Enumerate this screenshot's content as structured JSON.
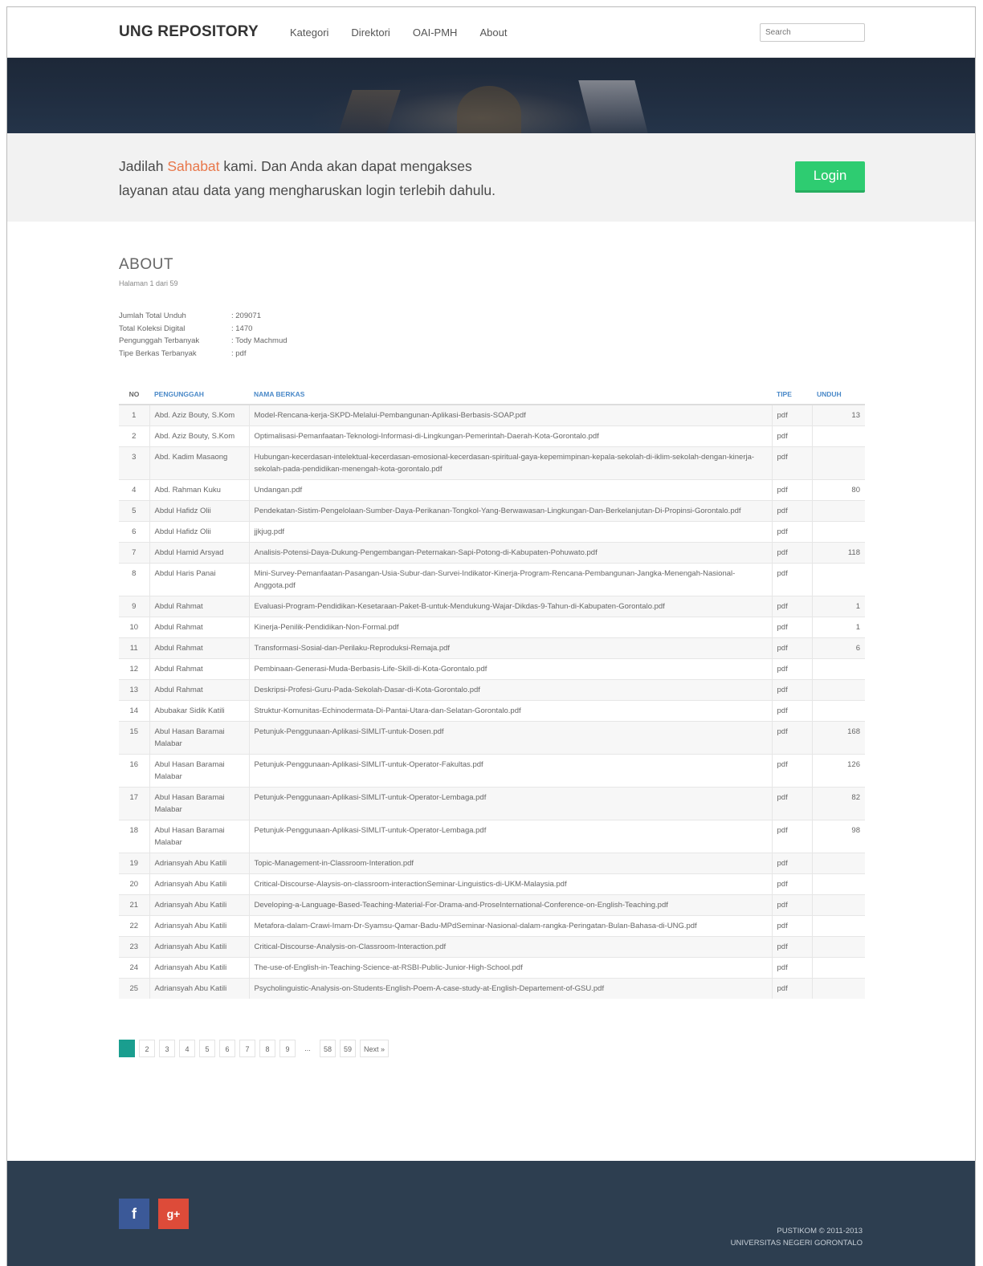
{
  "navbar": {
    "brand": "UNG REPOSITORY",
    "links": [
      "Kategori",
      "Direktori",
      "OAI-PMH",
      "About"
    ],
    "search_placeholder": "Search"
  },
  "callout": {
    "line1_a": "Jadilah ",
    "line1_hl": "Sahabat",
    "line1_b": " kami. Dan Anda akan dapat mengakses",
    "line2": "layanan atau data yang mengharuskan login terlebih dahulu.",
    "login_label": "Login"
  },
  "about": {
    "title": "ABOUT",
    "subtitle": "Halaman 1 dari 59",
    "stats": [
      {
        "label": "Jumlah Total Unduh",
        "value": ": 209071"
      },
      {
        "label": "Total Koleksi Digital",
        "value": ": 1470"
      },
      {
        "label": "Pengunggah Terbanyak",
        "value": ": Tody Machmud"
      },
      {
        "label": "Tipe Berkas Terbanyak",
        "value": ": pdf"
      }
    ]
  },
  "table": {
    "headers": {
      "no": "NO",
      "pengunggah": "PENGUNGGAH",
      "nama": "NAMA BERKAS",
      "tipe": "TIPE",
      "unduh": "UNDUH"
    },
    "rows": [
      {
        "no": "1",
        "peng": "Abd. Aziz Bouty, S.Kom",
        "nama": "Model-Rencana-kerja-SKPD-Melalui-Pembangunan-Aplikasi-Berbasis-SOAP.pdf",
        "tipe": "pdf",
        "unduh": "13"
      },
      {
        "no": "2",
        "peng": "Abd. Aziz Bouty, S.Kom",
        "nama": "Optimalisasi-Pemanfaatan-Teknologi-Informasi-di-Lingkungan-Pemerintah-Daerah-Kota-Gorontalo.pdf",
        "tipe": "pdf",
        "unduh": ""
      },
      {
        "no": "3",
        "peng": "Abd. Kadim Masaong",
        "nama": "Hubungan-kecerdasan-intelektual-kecerdasan-emosional-kecerdasan-spiritual-gaya-kepemimpinan-kepala-sekolah-di-iklim-sekolah-dengan-kinerja-sekolah-pada-pendidikan-menengah-kota-gorontalo.pdf",
        "tipe": "pdf",
        "unduh": ""
      },
      {
        "no": "4",
        "peng": "Abd. Rahman Kuku",
        "nama": "Undangan.pdf",
        "tipe": "pdf",
        "unduh": "80"
      },
      {
        "no": "5",
        "peng": "Abdul Hafidz Olii",
        "nama": "Pendekatan-Sistim-Pengelolaan-Sumber-Daya-Perikanan-Tongkol-Yang-Berwawasan-Lingkungan-Dan-Berkelanjutan-Di-Propinsi-Gorontalo.pdf",
        "tipe": "pdf",
        "unduh": ""
      },
      {
        "no": "6",
        "peng": "Abdul Hafidz Olii",
        "nama": "jjkjug.pdf",
        "tipe": "pdf",
        "unduh": ""
      },
      {
        "no": "7",
        "peng": "Abdul Hamid Arsyad",
        "nama": "Analisis-Potensi-Daya-Dukung-Pengembangan-Peternakan-Sapi-Potong-di-Kabupaten-Pohuwato.pdf",
        "tipe": "pdf",
        "unduh": "118"
      },
      {
        "no": "8",
        "peng": "Abdul Haris Panai",
        "nama": "Mini-Survey-Pemanfaatan-Pasangan-Usia-Subur-dan-Survei-Indikator-Kinerja-Program-Rencana-Pembangunan-Jangka-Menengah-Nasional-Anggota.pdf",
        "tipe": "pdf",
        "unduh": ""
      },
      {
        "no": "9",
        "peng": "Abdul Rahmat",
        "nama": "Evaluasi-Program-Pendidikan-Kesetaraan-Paket-B-untuk-Mendukung-Wajar-Dikdas-9-Tahun-di-Kabupaten-Gorontalo.pdf",
        "tipe": "pdf",
        "unduh": "1"
      },
      {
        "no": "10",
        "peng": "Abdul Rahmat",
        "nama": "Kinerja-Penilik-Pendidikan-Non-Formal.pdf",
        "tipe": "pdf",
        "unduh": "1"
      },
      {
        "no": "11",
        "peng": "Abdul Rahmat",
        "nama": "Transformasi-Sosial-dan-Perilaku-Reproduksi-Remaja.pdf",
        "tipe": "pdf",
        "unduh": "6"
      },
      {
        "no": "12",
        "peng": "Abdul Rahmat",
        "nama": "Pembinaan-Generasi-Muda-Berbasis-Life-Skill-di-Kota-Gorontalo.pdf",
        "tipe": "pdf",
        "unduh": ""
      },
      {
        "no": "13",
        "peng": "Abdul Rahmat",
        "nama": "Deskripsi-Profesi-Guru-Pada-Sekolah-Dasar-di-Kota-Gorontalo.pdf",
        "tipe": "pdf",
        "unduh": ""
      },
      {
        "no": "14",
        "peng": "Abubakar Sidik Katili",
        "nama": "Struktur-Komunitas-Echinodermata-Di-Pantai-Utara-dan-Selatan-Gorontalo.pdf",
        "tipe": "pdf",
        "unduh": ""
      },
      {
        "no": "15",
        "peng": "Abul Hasan Baramai Malabar",
        "nama": "Petunjuk-Penggunaan-Aplikasi-SIMLIT-untuk-Dosen.pdf",
        "tipe": "pdf",
        "unduh": "168"
      },
      {
        "no": "16",
        "peng": "Abul Hasan Baramai Malabar",
        "nama": "Petunjuk-Penggunaan-Aplikasi-SIMLIT-untuk-Operator-Fakultas.pdf",
        "tipe": "pdf",
        "unduh": "126"
      },
      {
        "no": "17",
        "peng": "Abul Hasan Baramai Malabar",
        "nama": "Petunjuk-Penggunaan-Aplikasi-SIMLIT-untuk-Operator-Lembaga.pdf",
        "tipe": "pdf",
        "unduh": "82"
      },
      {
        "no": "18",
        "peng": "Abul Hasan Baramai Malabar",
        "nama": "Petunjuk-Penggunaan-Aplikasi-SIMLIT-untuk-Operator-Lembaga.pdf",
        "tipe": "pdf",
        "unduh": "98"
      },
      {
        "no": "19",
        "peng": "Adriansyah Abu Katili",
        "nama": "Topic-Management-in-Classroom-Interation.pdf",
        "tipe": "pdf",
        "unduh": ""
      },
      {
        "no": "20",
        "peng": "Adriansyah Abu Katili",
        "nama": "Critical-Discourse-Alaysis-on-classroom-interactionSeminar-Linguistics-di-UKM-Malaysia.pdf",
        "tipe": "pdf",
        "unduh": ""
      },
      {
        "no": "21",
        "peng": "Adriansyah Abu Katili",
        "nama": "Developing-a-Language-Based-Teaching-Material-For-Drama-and-ProseInternational-Conference-on-English-Teaching.pdf",
        "tipe": "pdf",
        "unduh": ""
      },
      {
        "no": "22",
        "peng": "Adriansyah Abu Katili",
        "nama": "Metafora-dalam-Crawi-Imam-Dr-Syamsu-Qamar-Badu-MPdSeminar-Nasional-dalam-rangka-Peringatan-Bulan-Bahasa-di-UNG.pdf",
        "tipe": "pdf",
        "unduh": ""
      },
      {
        "no": "23",
        "peng": "Adriansyah Abu Katili",
        "nama": "Critical-Discourse-Analysis-on-Classroom-Interaction.pdf",
        "tipe": "pdf",
        "unduh": ""
      },
      {
        "no": "24",
        "peng": "Adriansyah Abu Katili",
        "nama": "The-use-of-English-in-Teaching-Science-at-RSBI-Public-Junior-High-School.pdf",
        "tipe": "pdf",
        "unduh": ""
      },
      {
        "no": "25",
        "peng": "Adriansyah Abu Katili",
        "nama": "Psycholinguistic-Analysis-on-Students-English-Poem-A-case-study-at-English-Departement-of-GSU.pdf",
        "tipe": "pdf",
        "unduh": ""
      }
    ]
  },
  "pagination": {
    "pages": [
      "1",
      "2",
      "3",
      "4",
      "5",
      "6",
      "7",
      "8",
      "9",
      "...",
      "58",
      "59",
      "Next »"
    ],
    "current": "1"
  },
  "footer": {
    "facebook_glyph": "f",
    "gplus_glyph": "g+",
    "line1": "PUSTIKOM © 2011-2013",
    "line2": "UNIVERSITAS NEGERI GORONTALO"
  }
}
